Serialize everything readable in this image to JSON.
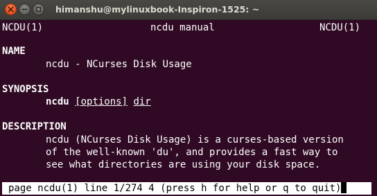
{
  "window": {
    "title": "himanshu@mylinuxbook-Inspiron-1525: ~",
    "buttons": {
      "close": "close-icon",
      "minimize": "minimize-icon",
      "maximize": "maximize-icon"
    }
  },
  "manpage": {
    "header_left": "NCDU(1)",
    "header_center": "ncdu manual",
    "header_right": "NCDU(1)",
    "name_heading": "NAME",
    "name_text": "ncdu - NCurses Disk Usage",
    "synopsis_heading": "SYNOPSIS",
    "synopsis_command": "ncdu",
    "synopsis_options": "[options]",
    "synopsis_dir": "dir",
    "description_heading": "DESCRIPTION",
    "description_lines": [
      "ncdu (NCurses Disk Usage) is a curses-based version",
      "of the well-known 'du', and provides a fast way to",
      "see what directories are using your disk space."
    ]
  },
  "status_bar": {
    "text": "page ncdu(1) line 1/274 4 (press h for help or q to quit)"
  },
  "colors": {
    "terminal_background": "#300a24",
    "terminal_foreground": "#ffffff",
    "titlebar": "#3c3b37",
    "close_button": "#e2501e"
  }
}
